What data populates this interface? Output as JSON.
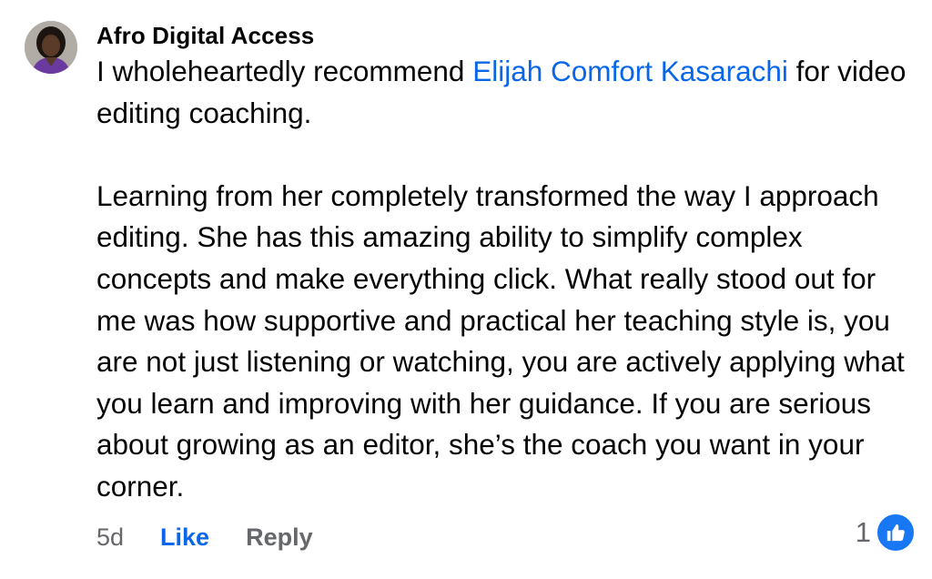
{
  "comment": {
    "author": "Afro Digital Access",
    "text_before_mention": "I wholeheartedly recommend ",
    "mention": "Elijah Comfort Kasarachi",
    "text_after_mention": " for video editing coaching.",
    "paragraph_2": "Learning from her completely transformed the way I approach editing. She has this amazing ability to simplify complex concepts and make everything click. What really stood out for me was how supportive and practical her teaching style is, you are not just listening or watching, you are actively applying what you learn and improving with her guidance. If you are serious about growing as an editor, she’s the coach you want in your corner."
  },
  "actions": {
    "time": "5d",
    "like": "Like",
    "reply": "Reply"
  },
  "reactions": {
    "count": "1",
    "icon": "thumbs-up-icon"
  },
  "colors": {
    "mention": "#0a66e8",
    "like_active": "#0a66e8",
    "secondary_text": "#65676b",
    "reaction_badge": "#1877f2"
  }
}
